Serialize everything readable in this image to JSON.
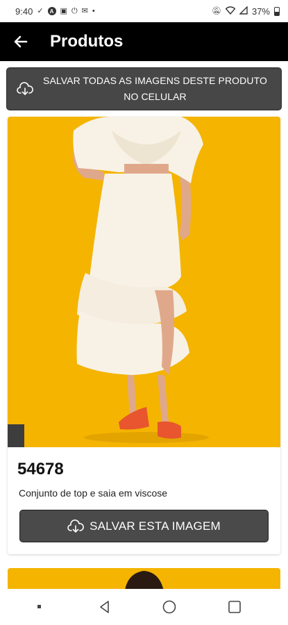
{
  "status_bar": {
    "time": "9:40",
    "battery_text": "37%"
  },
  "app_bar": {
    "title": "Produtos",
    "back_icon": "arrow-left-icon"
  },
  "save_all": {
    "label": "SALVAR TODAS AS IMAGENS DESTE PRODUTO NO CELULAR",
    "icon": "cloud-download-icon"
  },
  "product": {
    "sku": "54678",
    "description": "Conjunto de top e saia em viscose",
    "save_label": "SALVAR ESTA IMAGEM",
    "image_background": "#f4b400"
  },
  "colors": {
    "app_bar": "#000000",
    "button": "#474747",
    "accent_yellow": "#f4b400"
  }
}
